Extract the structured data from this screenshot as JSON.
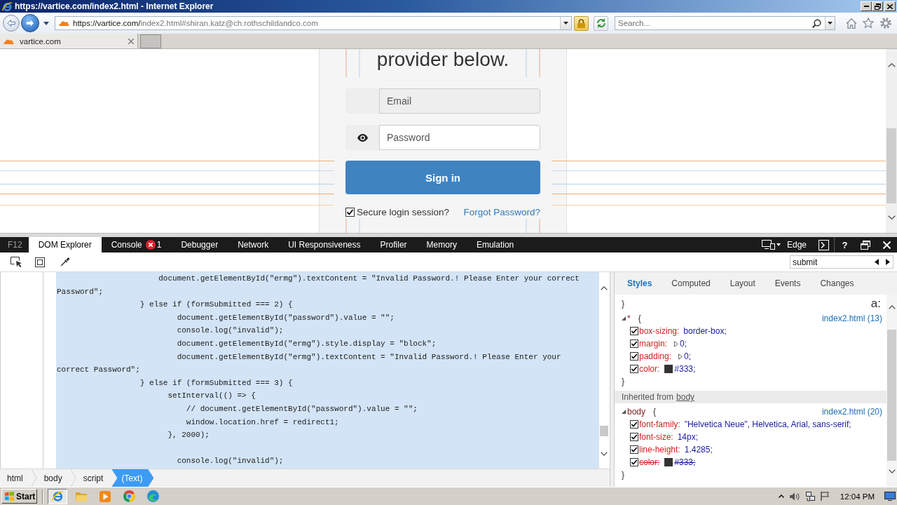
{
  "window": {
    "title": "https://vartice.com/index2.html - Internet Explorer"
  },
  "navigation": {
    "address": {
      "host": "https://vartice.com/",
      "path": "index2.html#shiran.katz@ch.rothschildandco.com"
    },
    "search": {
      "placeholder": "Search..."
    }
  },
  "tabs": [
    {
      "label": "vartice.com",
      "selected": true
    }
  ],
  "page": {
    "heading": "provider below.",
    "fields": [
      {
        "kind": "email",
        "placeholder": "Email",
        "disabled": true
      },
      {
        "kind": "password",
        "placeholder": "Password",
        "disabled": false
      }
    ],
    "submit_button": "Sign in",
    "remember": {
      "label": "Secure login session?",
      "checked": true
    },
    "forgot_link": "Forgot Password?"
  },
  "devtools": {
    "label": "F12",
    "tabs": [
      {
        "label": "DOM Explorer",
        "selected": true
      },
      {
        "label": "Console",
        "selected": false,
        "badge": "1"
      },
      {
        "label": "Debugger",
        "selected": false
      },
      {
        "label": "Network",
        "selected": false
      },
      {
        "label": "UI Responsiveness",
        "selected": false
      },
      {
        "label": "Profiler",
        "selected": false
      },
      {
        "label": "Memory",
        "selected": false
      },
      {
        "label": "Emulation",
        "selected": false
      }
    ],
    "document_mode": "Edge",
    "help": "?",
    "find": {
      "value": "submit"
    },
    "code": "                      document.getElementById(\"ermg\").textContent = \"Invalid Password.! Please Enter your correct Password\";\n                  } else if (formSubmitted === 2) {\n                          document.getElementById(\"password\").value = \"\";\n                          console.log(\"invalid\");\n                          document.getElementById(\"ermg\").style.display = \"block\";\n                          document.getElementById(\"ermg\").textContent = \"Invalid Password.! Please Enter your correct Password\";\n                  } else if (formSubmitted === 3) {\n                        setInterval(() => {\n                            // document.getElementById(\"password\").value = \"\";\n                            window.location.href = redirect1;\n                        }, 2000);\n\n                          console.log(\"invalid\");",
    "breadcrumb": [
      {
        "label": "html",
        "selected": false
      },
      {
        "label": "body",
        "selected": false
      },
      {
        "label": "script",
        "selected": false
      },
      {
        "label": "(Text)",
        "selected": true
      }
    ],
    "styles": {
      "tabs": [
        {
          "label": "Styles",
          "selected": true
        },
        {
          "label": "Computed",
          "selected": false
        },
        {
          "label": "Layout",
          "selected": false
        },
        {
          "label": "Events",
          "selected": false
        },
        {
          "label": "Changes",
          "selected": false
        }
      ],
      "leading_close": "}",
      "pseudo_toggle": "a:",
      "rules": [
        {
          "selector": "*",
          "open": "{",
          "close": "}",
          "source": "index2.html (13)",
          "expanded": true,
          "declarations": [
            {
              "kind": "plain",
              "property": "box-sizing:",
              "value": "border-box;",
              "checked": true,
              "overridden": false
            },
            {
              "kind": "shorthand",
              "property": "margin:",
              "value": "0;",
              "checked": true,
              "overridden": false
            },
            {
              "kind": "shorthand",
              "property": "padding:",
              "value": "0;",
              "checked": true,
              "overridden": false
            },
            {
              "kind": "color",
              "property": "color:",
              "value": "#333;",
              "color": "#333333",
              "checked": true,
              "overridden": false
            }
          ]
        },
        {
          "inherited": {
            "label": "Inherited from",
            "element": "body"
          },
          "selector": "body",
          "open": "{",
          "close": "}",
          "source": "index2.html (20)",
          "expanded": true,
          "declarations": [
            {
              "kind": "plain",
              "property": "font-family:",
              "value": "\"Helvetica Neue\", Helvetica, Arial, sans-serif;",
              "checked": true,
              "overridden": false
            },
            {
              "kind": "plain",
              "property": "font-size:",
              "value": "14px;",
              "checked": true,
              "overridden": false
            },
            {
              "kind": "plain",
              "property": "line-height:",
              "value": "1.4285;",
              "checked": true,
              "overridden": false
            },
            {
              "kind": "color",
              "property": "color:",
              "value": "#333;",
              "color": "#333333",
              "checked": true,
              "overridden": true
            }
          ]
        }
      ]
    }
  },
  "taskbar": {
    "start": "Start",
    "apps": [
      {
        "kind": "e-browser",
        "selected": true
      },
      {
        "kind": "folder",
        "selected": false
      },
      {
        "kind": "media-player",
        "selected": false
      },
      {
        "kind": "round-browser",
        "selected": false
      },
      {
        "kind": "swirl-browser",
        "selected": false
      }
    ],
    "clock": "12:04 PM"
  }
}
